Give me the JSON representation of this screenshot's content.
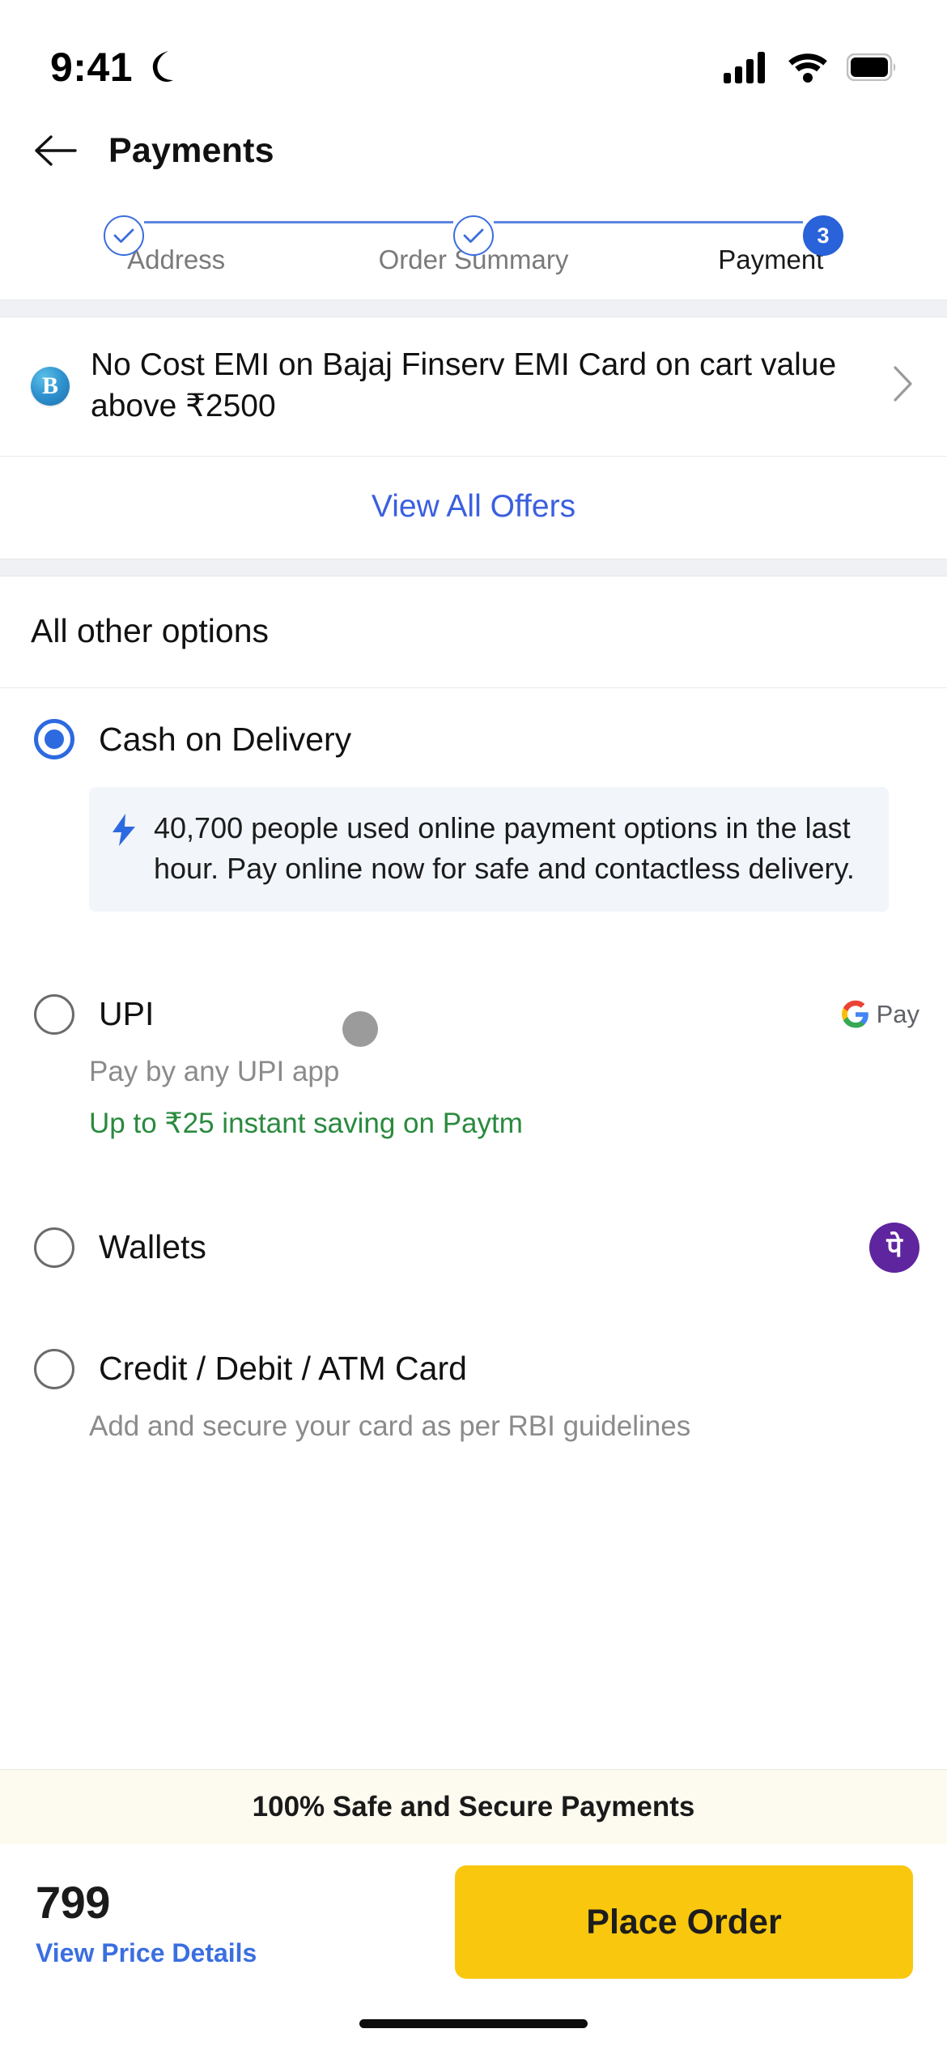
{
  "status_bar": {
    "time": "9:41",
    "dnd_icon": "crescent-moon-icon",
    "cellular_icon": "cellular-signal-icon",
    "wifi_icon": "wifi-icon",
    "battery_icon": "battery-full-icon"
  },
  "header": {
    "back_icon": "arrow-left-icon",
    "title": "Payments"
  },
  "stepper": {
    "steps": [
      {
        "label": "Address",
        "state": "completed",
        "marker": "check"
      },
      {
        "label": "Order Summary",
        "state": "completed",
        "marker": "check"
      },
      {
        "label": "Payment",
        "state": "current",
        "marker": "3"
      }
    ]
  },
  "offers": {
    "offer_icon": "bajaj-finserv-icon",
    "offer_text": "No Cost EMI on Bajaj Finserv EMI Card on cart value above ₹2500",
    "chevron_icon": "chevron-right-icon",
    "view_all_label": "View All Offers"
  },
  "options_section": {
    "heading": "All other options",
    "items": [
      {
        "id": "cash-on-delivery",
        "label": "Cash on Delivery",
        "selected": true,
        "note_icon": "lightning-bolt-icon",
        "note": "40,700 people used online payment options in the last hour. Pay online now for safe and contactless delivery."
      },
      {
        "id": "upi",
        "label": "UPI",
        "selected": false,
        "subtitle": "Pay by any UPI app",
        "saving": "Up to ₹25 instant saving on Paytm",
        "brand_icon": "google-pay-icon",
        "brand_label": "Pay"
      },
      {
        "id": "wallets",
        "label": "Wallets",
        "selected": false,
        "brand_icon": "phonepe-icon",
        "brand_glyph": "पे"
      },
      {
        "id": "credit-debit-atm-card",
        "label": "Credit / Debit / ATM Card",
        "selected": false,
        "subtitle": "Add and secure your card as per RBI guidelines"
      }
    ]
  },
  "footer": {
    "safe_banner": "100% Safe and Secure Payments",
    "price_amount": "799",
    "price_details_link": "View Price Details",
    "place_order_label": "Place Order"
  },
  "colors": {
    "accent_blue": "#2d6ae0",
    "link_blue": "#3b5fe0",
    "saving_green": "#2a8a3e",
    "cta_yellow": "#f9c70e",
    "phonepe_purple": "#5f259f",
    "banner_cream": "#fdfbef"
  }
}
